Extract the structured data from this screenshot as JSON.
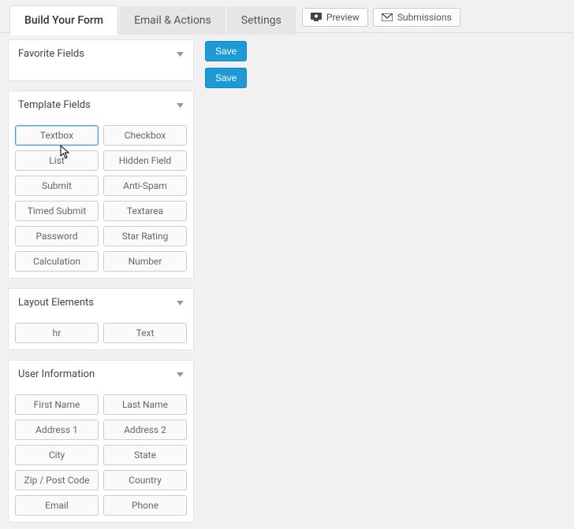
{
  "tabs": {
    "build": "Build Your Form",
    "email": "Email & Actions",
    "settings": "Settings"
  },
  "topButtons": {
    "preview": "Preview",
    "submissions": "Submissions"
  },
  "panels": {
    "favorite": {
      "title": "Favorite Fields"
    },
    "template": {
      "title": "Template Fields",
      "items": [
        "Textbox",
        "Checkbox",
        "List",
        "Hidden Field",
        "Submit",
        "Anti-Spam",
        "Timed Submit",
        "Textarea",
        "Password",
        "Star Rating",
        "Calculation",
        "Number"
      ]
    },
    "layout": {
      "title": "Layout Elements",
      "items": [
        "hr",
        "Text"
      ]
    },
    "user": {
      "title": "User Information",
      "items": [
        "First Name",
        "Last Name",
        "Address 1",
        "Address 2",
        "City",
        "State",
        "Zip / Post Code",
        "Country",
        "Email",
        "Phone"
      ]
    }
  },
  "buttons": {
    "save": "Save"
  }
}
